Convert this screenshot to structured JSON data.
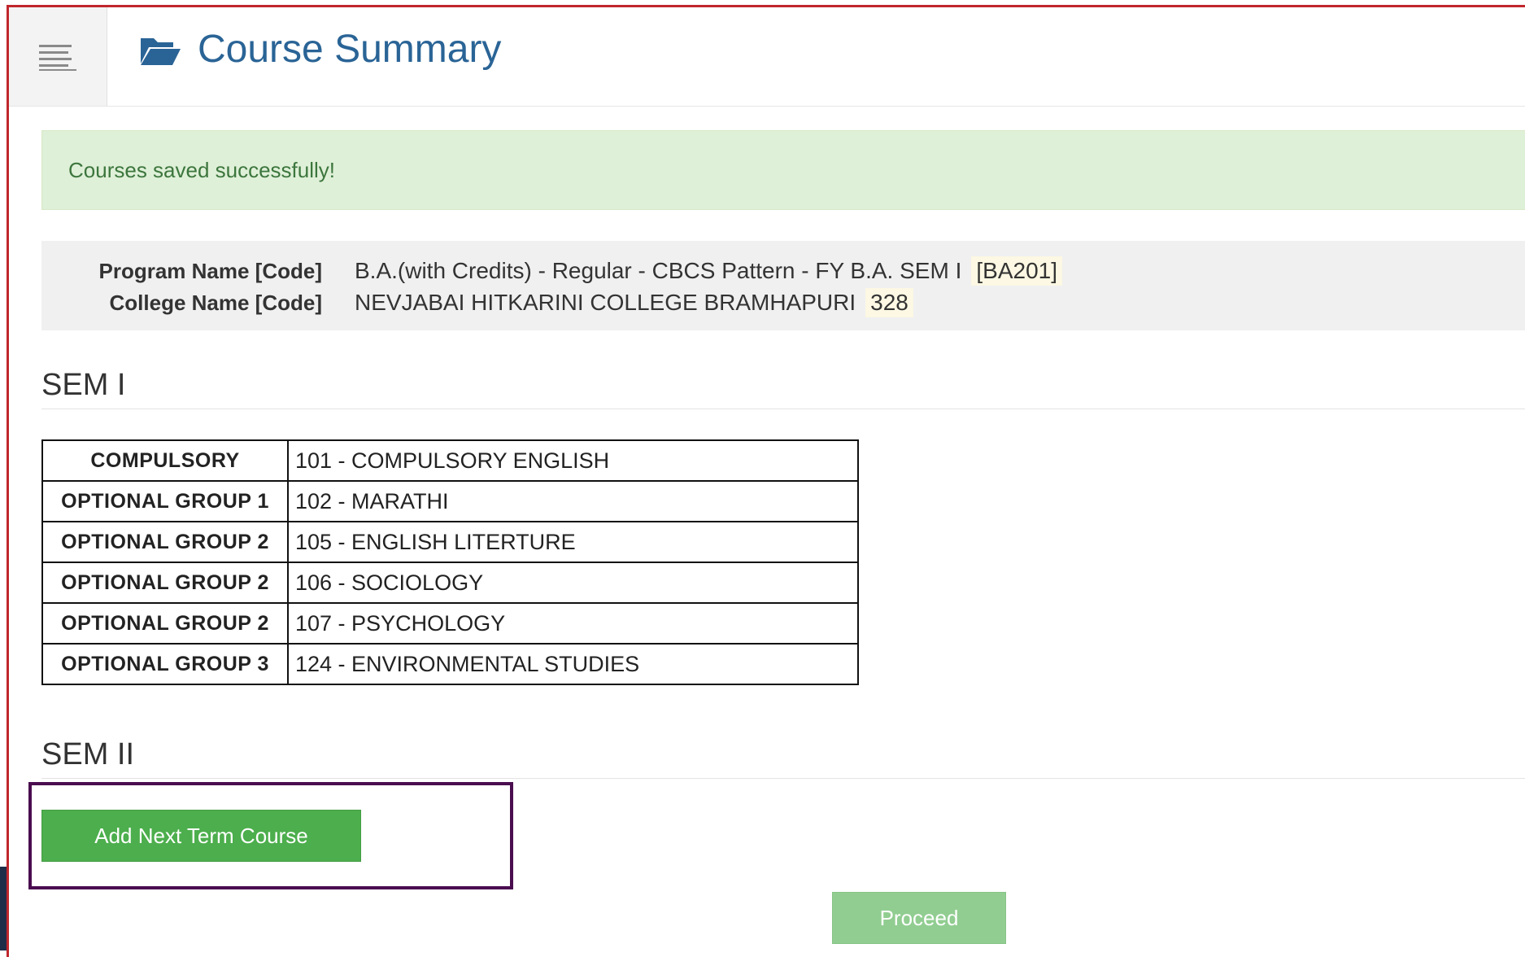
{
  "header": {
    "title": "Course Summary",
    "menu_icon": "hamburger-menu-icon",
    "title_icon": "folder-open-icon",
    "title_color": "#2a6496"
  },
  "alert": {
    "message": "Courses saved successfully!",
    "background": "#dff0d8",
    "text_color": "#3c763d"
  },
  "program_info": {
    "program_label": "Program Name [Code]",
    "program_value": "B.A.(with Credits) - Regular - CBCS Pattern - FY B.A. SEM I",
    "program_code": "[BA201]",
    "college_label": "College Name [Code]",
    "college_value": "NEVJABAI HITKARINI COLLEGE BRAMHAPURI",
    "college_code": "328"
  },
  "sem1": {
    "heading": "SEM I",
    "courses": [
      {
        "group": "COMPULSORY",
        "course": "101 - COMPULSORY ENGLISH"
      },
      {
        "group": "OPTIONAL GROUP 1",
        "course": "102 - MARATHI"
      },
      {
        "group": "OPTIONAL GROUP 2",
        "course": "105 - ENGLISH LITERTURE"
      },
      {
        "group": "OPTIONAL GROUP 2",
        "course": "106 - SOCIOLOGY"
      },
      {
        "group": "OPTIONAL GROUP 2",
        "course": "107 - PSYCHOLOGY"
      },
      {
        "group": "OPTIONAL GROUP 3",
        "course": "124 - ENVIRONMENTAL STUDIES"
      }
    ]
  },
  "sem2": {
    "heading": "SEM II"
  },
  "actions": {
    "add_next_term": "Add Next Term Course",
    "proceed": "Proceed",
    "add_color": "#4cae4c",
    "proceed_color": "#91cd91"
  }
}
